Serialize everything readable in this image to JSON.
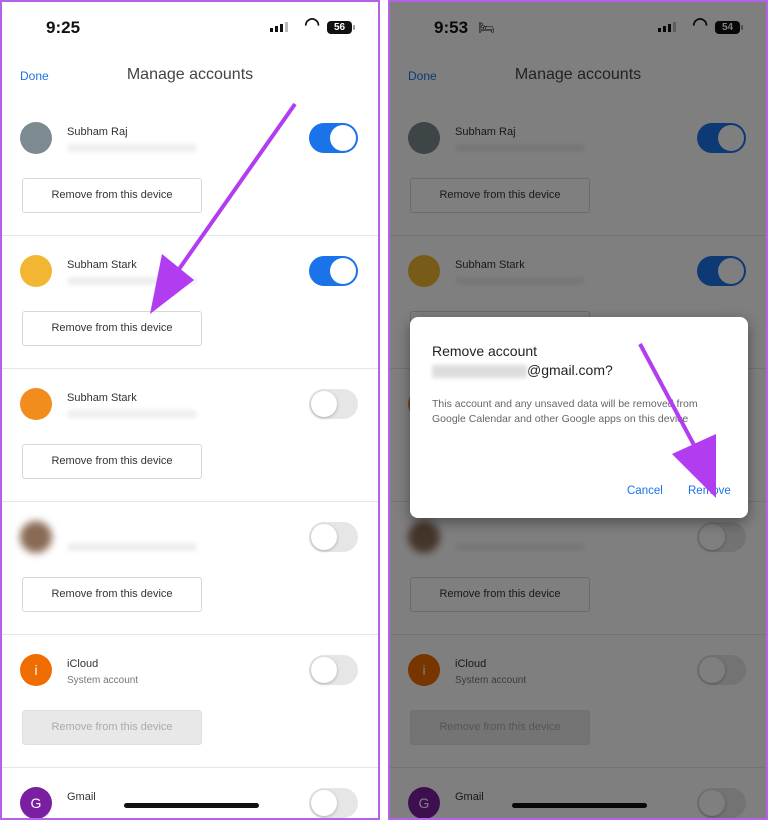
{
  "left": {
    "status": {
      "time": "9:25",
      "battery": "56"
    }
  },
  "right": {
    "status": {
      "time": "9:53",
      "battery": "54"
    }
  },
  "header": {
    "done_label": "Done",
    "title": "Manage accounts"
  },
  "accounts": [
    {
      "name": "Subham Raj",
      "enabled": true,
      "remove_label": "Remove from this device",
      "avatar_color": "#7d8a8f"
    },
    {
      "name": "Subham Stark",
      "enabled": true,
      "remove_label": "Remove from this device",
      "avatar_color": "#f2b632"
    },
    {
      "name": "Subham Stark",
      "enabled": false,
      "remove_label": "Remove from this device",
      "avatar_color": "#f28c1d"
    },
    {
      "name": "",
      "enabled": false,
      "remove_label": "Remove from this device",
      "avatar_color": "#8a6a55"
    },
    {
      "name": "iCloud",
      "subtitle": "System account",
      "avatar_letter": "i",
      "enabled": false,
      "remove_label": "Remove from this device",
      "remove_disabled": true,
      "avatar_color": "#ef6c00"
    },
    {
      "name": "Gmail",
      "avatar_letter": "G",
      "enabled": false,
      "avatar_color": "#7b1fa2"
    }
  ],
  "dialog": {
    "title_line1": "Remove account",
    "email_suffix": "@gmail.com?",
    "body": "This account and any unsaved data will be removed from Google Calendar and other Google apps on this device",
    "cancel_label": "Cancel",
    "remove_label": "Remove"
  },
  "colors": {
    "accent": "#1a73e8",
    "annotation_arrow": "#b23cf0",
    "frame": "#b562e8"
  }
}
